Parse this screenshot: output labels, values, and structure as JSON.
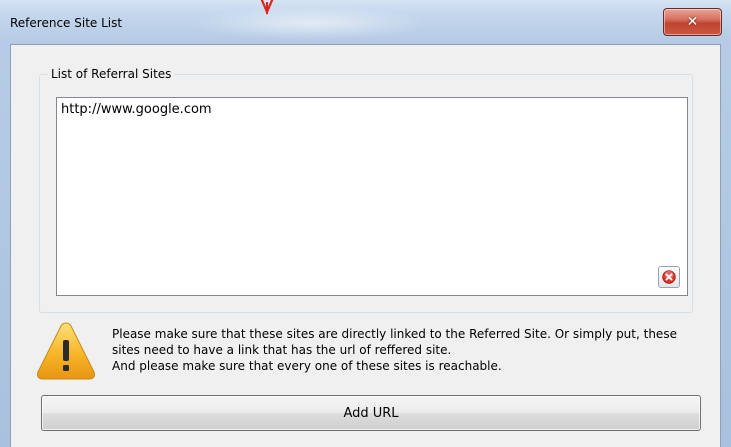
{
  "window": {
    "title": "Reference Site List",
    "close_glyph": "✕"
  },
  "group": {
    "legend": "List of Referral Sites",
    "items": [
      "http://www.google.com"
    ]
  },
  "warning": {
    "line1": "Please make sure that these sites are directly linked to the Referred Site. Or simply put, these",
    "line2": "sites need to have a link that has the url of reffered site.",
    "line3": "And please make sure that every one of these sites is reachable."
  },
  "actions": {
    "add_url_label": "Add URL"
  },
  "icons": {
    "close": "close-icon",
    "remove": "remove-icon",
    "warning": "warning-icon",
    "pointer": "arrow-down-icon"
  },
  "colors": {
    "close_button": "#c0432f",
    "warning_fill": "#f5b21a",
    "remove_icon": "#d9342b",
    "pointer_arrow": "#e0211c"
  }
}
